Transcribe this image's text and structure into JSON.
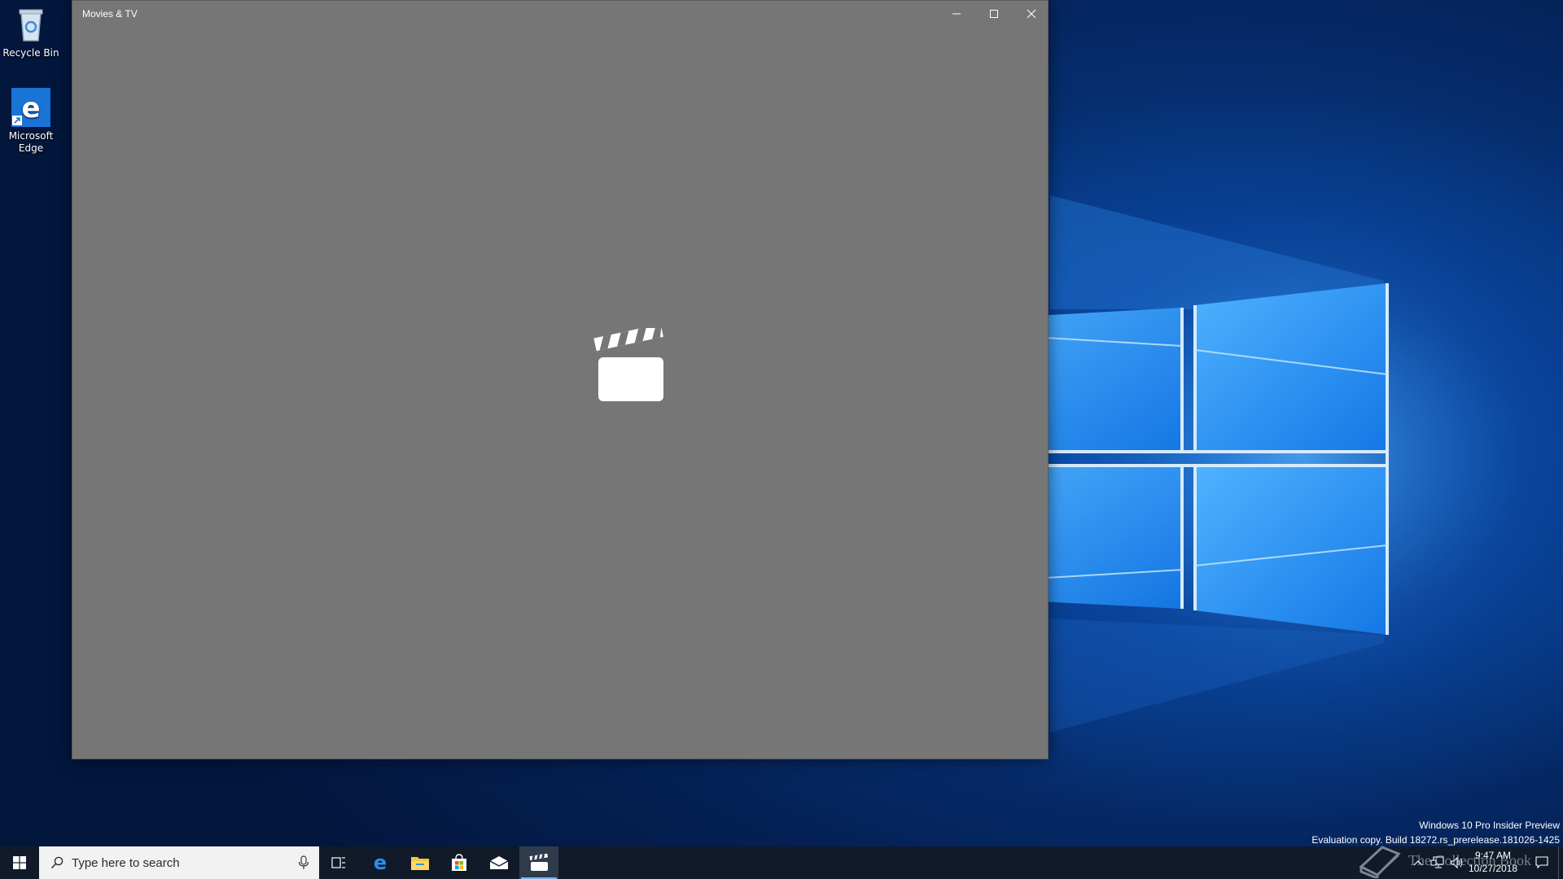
{
  "desktop": {
    "icons": [
      {
        "label": "Recycle Bin",
        "icon": "recycle-bin-icon"
      },
      {
        "label": "Microsoft Edge",
        "icon": "edge-icon"
      }
    ]
  },
  "window": {
    "title": "Movies & TV",
    "background_color": "#767676",
    "center_icon": "clapperboard-icon",
    "controls": {
      "minimize": "minimize-icon",
      "maximize": "maximize-icon",
      "close": "close-icon"
    }
  },
  "watermark": {
    "line1": "Windows 10 Pro Insider Preview",
    "line2": "Evaluation copy. Build 18272.rs_prerelease.181026-1425"
  },
  "taskbar": {
    "search_placeholder": "Type here to search",
    "apps": [
      {
        "name": "task-view",
        "icon": "task-view-icon"
      },
      {
        "name": "edge",
        "icon": "edge-icon"
      },
      {
        "name": "file-explorer",
        "icon": "folder-icon"
      },
      {
        "name": "store",
        "icon": "store-icon"
      },
      {
        "name": "mail",
        "icon": "mail-icon"
      },
      {
        "name": "movies-tv",
        "icon": "clapperboard-icon",
        "active": true
      }
    ],
    "overlay_text": "The Collection Book",
    "clock": {
      "time": "9:47 AM",
      "date": "10/27/2018"
    },
    "accent_color": "#7fb4ea"
  }
}
